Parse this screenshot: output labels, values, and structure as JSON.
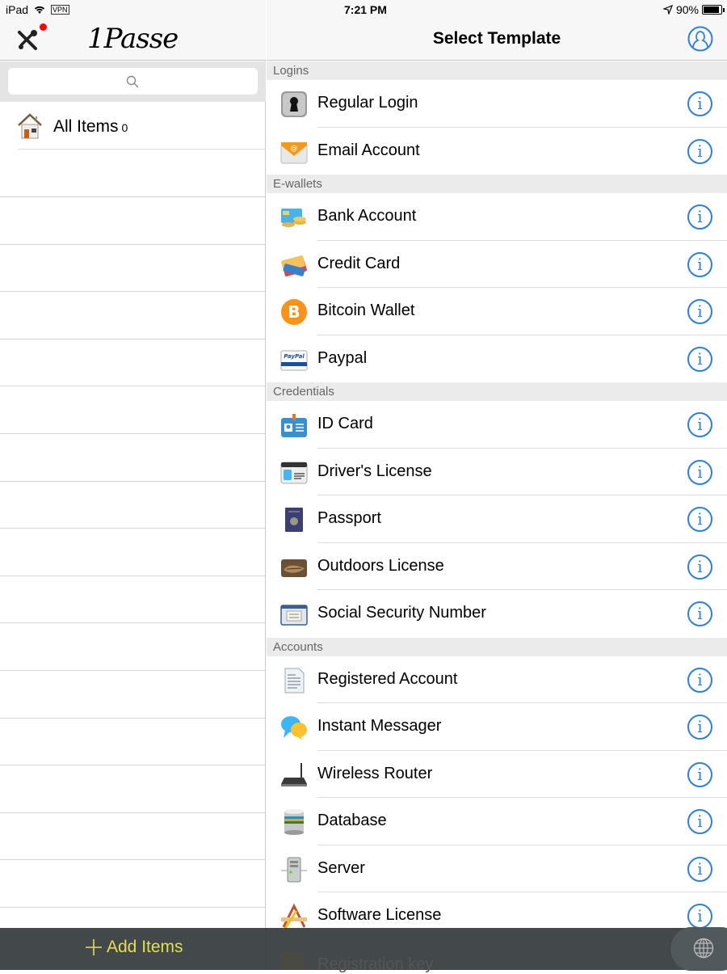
{
  "status_bar": {
    "device": "iPad",
    "vpn": "VPN",
    "time": "7:21 PM",
    "battery": "90%",
    "battery_level": 0.9
  },
  "left": {
    "logo": "1Passe",
    "search_placeholder": "",
    "all_items": {
      "label": "All Items",
      "count": "0"
    }
  },
  "right": {
    "title": "Select Template",
    "sections": [
      {
        "name": "Logins",
        "items": [
          {
            "label": "Regular Login",
            "icon": "keyhole-icon"
          },
          {
            "label": "Email Account",
            "icon": "email-icon"
          }
        ]
      },
      {
        "name": "E-wallets",
        "items": [
          {
            "label": "Bank Account",
            "icon": "bank-icon"
          },
          {
            "label": "Credit Card",
            "icon": "credit-card-icon"
          },
          {
            "label": "Bitcoin Wallet",
            "icon": "bitcoin-icon"
          },
          {
            "label": "Paypal",
            "icon": "paypal-icon"
          }
        ]
      },
      {
        "name": "Credentials",
        "items": [
          {
            "label": "ID Card",
            "icon": "id-card-icon"
          },
          {
            "label": "Driver's License",
            "icon": "drivers-license-icon"
          },
          {
            "label": "Passport",
            "icon": "passport-icon"
          },
          {
            "label": "Outdoors License",
            "icon": "outdoors-license-icon"
          },
          {
            "label": "Social Security Number",
            "icon": "ssn-card-icon"
          }
        ]
      },
      {
        "name": "Accounts",
        "items": [
          {
            "label": "Registered Account",
            "icon": "document-icon"
          },
          {
            "label": "Instant Messager",
            "icon": "chat-bubbles-icon"
          },
          {
            "label": "Wireless Router",
            "icon": "router-icon"
          },
          {
            "label": "Database",
            "icon": "database-icon"
          },
          {
            "label": "Server",
            "icon": "server-icon"
          },
          {
            "label": "Software License",
            "icon": "software-license-icon"
          }
        ]
      }
    ],
    "partially_hidden_item": "Registration key"
  },
  "bottom_bar": {
    "add_label": "Add Items"
  },
  "colors": {
    "accent": "#2f7fd6",
    "add_button": "#e3df52",
    "badge": "#ff0000"
  }
}
